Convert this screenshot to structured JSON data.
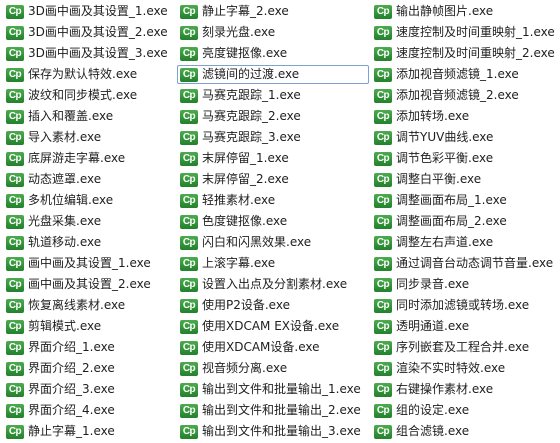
{
  "icon": {
    "name": "cp-app-icon",
    "glyph": "Cp",
    "color": "#2f8f3a"
  },
  "columns": [
    {
      "items": [
        "3D画中画及其设置_1.exe",
        "3D画中画及其设置_2.exe",
        "3D画中画及其设置_3.exe",
        "保存为默认特效.exe",
        "波纹和同步模式.exe",
        "插入和覆盖.exe",
        "导入素材.exe",
        "底屏游走字幕.exe",
        "动态遮罩.exe",
        "多机位编辑.exe",
        "光盘采集.exe",
        "轨道移动.exe",
        "画中画及其设置_1.exe",
        "画中画及其设置_2.exe",
        "恢复离线素材.exe",
        "剪辑模式.exe",
        "界面介绍_1.exe",
        "界面介绍_2.exe",
        "界面介绍_3.exe",
        "界面介绍_4.exe",
        "静止字幕_1.exe"
      ]
    },
    {
      "items": [
        "静止字幕_2.exe",
        "刻录光盘.exe",
        "亮度键抠像.exe",
        "滤镜间的过渡.exe",
        "马赛克跟踪_1.exe",
        "马赛克跟踪_2.exe",
        "马赛克跟踪_3.exe",
        "末屏停留_1.exe",
        "末屏停留_2.exe",
        "轻推素材.exe",
        "色度键抠像.exe",
        "闪白和闪黑效果.exe",
        "上滚字幕.exe",
        "设置入出点及分割素材.exe",
        "使用P2设备.exe",
        "使用XDCAM EX设备.exe",
        "使用XDCAM设备.exe",
        "视音频分离.exe",
        "输出到文件和批量输出_1.exe",
        "输出到文件和批量输出_2.exe",
        "输出到文件和批量输出_3.exe"
      ]
    },
    {
      "items": [
        "输出静帧图片.exe",
        "速度控制及时间重映射_1.exe",
        "速度控制及时间重映射_2.exe",
        "添加视音频滤镜_1.exe",
        "添加视音频滤镜_2.exe",
        "添加转场.exe",
        "调节YUV曲线.exe",
        "调节色彩平衡.exe",
        "调整白平衡.exe",
        "调整画面布局_1.exe",
        "调整画面布局_2.exe",
        "调整左右声道.exe",
        "通过调音台动态调节音量.exe",
        "同步录音.exe",
        "同时添加滤镜或转场.exe",
        "透明通道.exe",
        "序列嵌套及工程合并.exe",
        "渲染不实时特效.exe",
        "右键操作素材.exe",
        "组的设定.exe",
        "组合滤镜.exe"
      ]
    }
  ],
  "selected": {
    "column": 1,
    "index": 3
  }
}
